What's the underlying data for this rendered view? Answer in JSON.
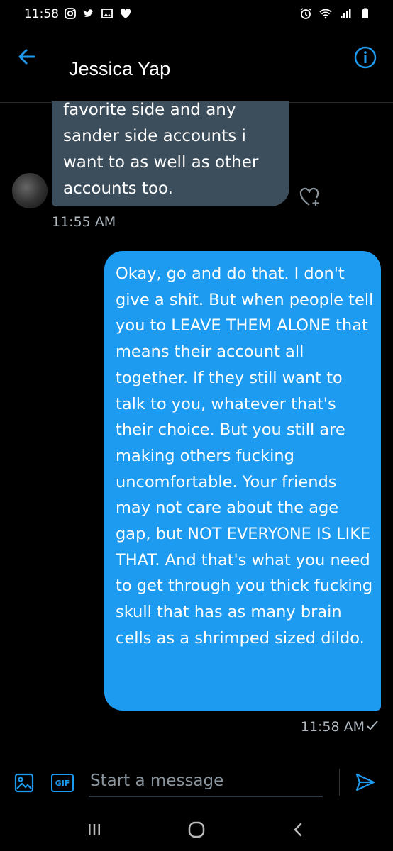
{
  "status_bar": {
    "time": "11:58",
    "left_icons": [
      "instagram-icon",
      "twitter-icon",
      "gallery-icon",
      "heart-icon"
    ],
    "right_icons": [
      "alarm-icon",
      "wifi-icon",
      "signal-icon",
      "battery-icon"
    ]
  },
  "header": {
    "title": "Jessica Yap",
    "back_icon": "arrow-left-icon",
    "info_icon": "info-icon"
  },
  "messages": [
    {
      "direction": "incoming",
      "text": "favorite side and any\nsander side accounts i\nwant to as well as other\naccounts too.",
      "time": "11:55 AM"
    },
    {
      "direction": "outgoing",
      "text": "Okay, go and do that. I don't give a shit. But when people tell you to LEAVE THEM ALONE that means their account all together. If they still want to talk to you, whatever that's their choice. But you still are making others fucking uncomfortable. Your friends may not care about the age gap, but NOT EVERYONE IS LIKE THAT. And that's what you need to get through you thick fucking skull that has as many brain cells as a shrimped sized dildo.",
      "time": "11:58 AM",
      "status_icon": "check-icon"
    }
  ],
  "composer": {
    "placeholder": "Start a message",
    "gif_label": "GIF"
  },
  "colors": {
    "accent": "#1d9bf0",
    "incoming_bubble": "#3c4d5b",
    "background": "#000000"
  }
}
